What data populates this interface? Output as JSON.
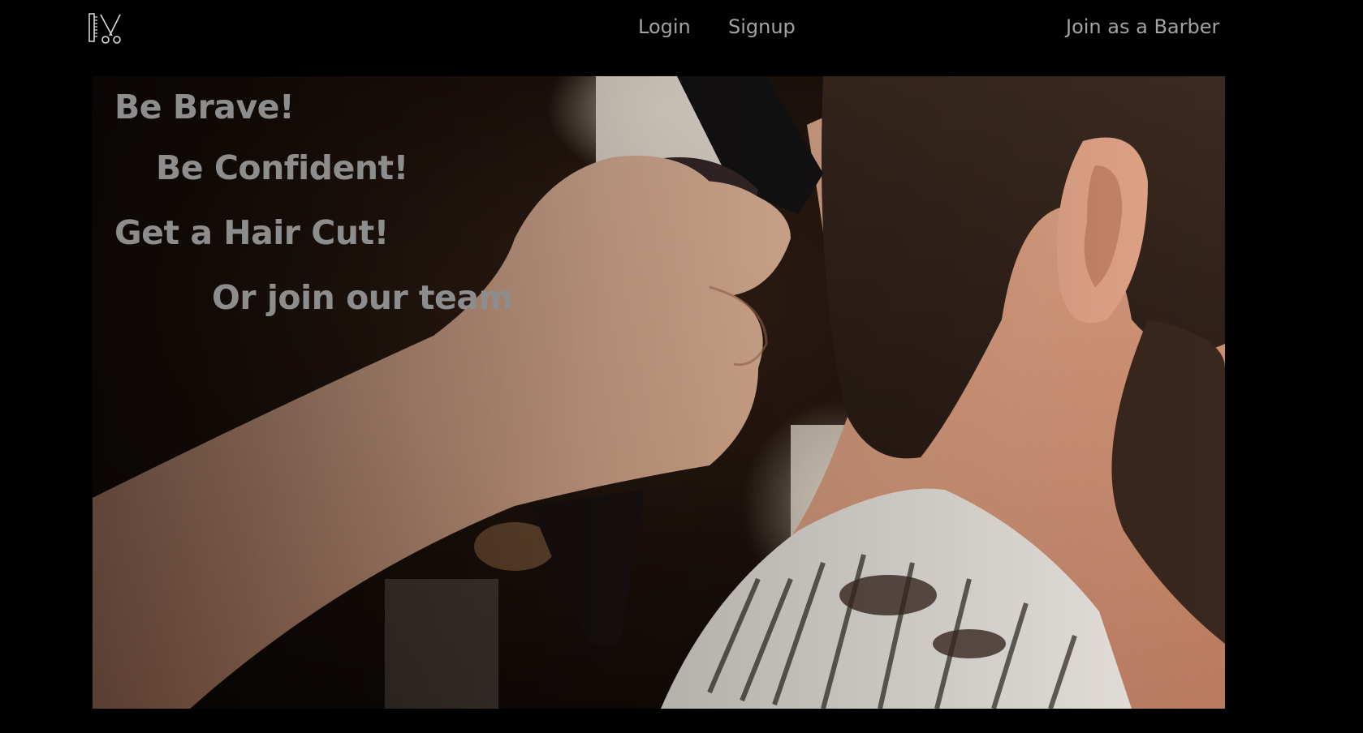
{
  "nav": {
    "logo_icon": "comb-scissors-icon",
    "login_label": "Login",
    "signup_label": "Signup",
    "barber_label": "Join as a Barber"
  },
  "hero": {
    "image": "barber-haircut-photo",
    "lines": [
      "Be Brave!",
      "Be Confident!",
      "Get a Hair Cut!",
      "Or join our team"
    ]
  },
  "colors": {
    "background": "#000000",
    "nav_text": "#a3a3a3",
    "tagline_text": "#8d8d8d"
  }
}
